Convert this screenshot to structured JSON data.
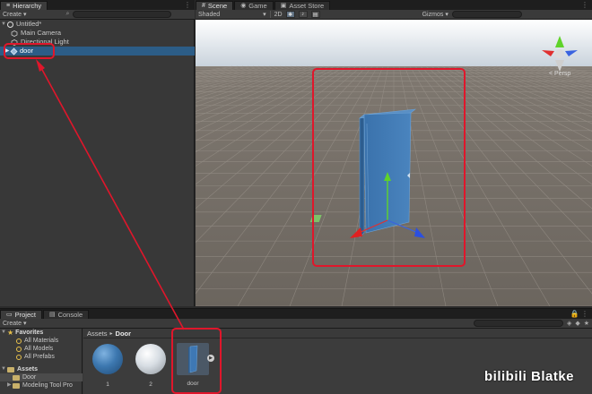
{
  "hierarchy": {
    "tab_label": "Hierarchy",
    "create_label": "Create ▾",
    "scene_name": "Untitled*",
    "items": [
      {
        "label": "Main Camera"
      },
      {
        "label": "Directional Light"
      },
      {
        "label": "door"
      }
    ]
  },
  "scene": {
    "tabs": [
      {
        "label": "Scene"
      },
      {
        "label": "Game"
      },
      {
        "label": "Asset Store"
      }
    ],
    "shading_mode": "Shaded",
    "mode_2d": "2D",
    "gizmos_label": "Gizmos",
    "persp_label": "< Persp"
  },
  "project": {
    "tabs": [
      {
        "label": "Project"
      },
      {
        "label": "Console"
      }
    ],
    "create_label": "Create ▾",
    "favorites": {
      "header": "Favorites",
      "items": [
        {
          "label": "All Materials"
        },
        {
          "label": "All Models"
        },
        {
          "label": "All Prefabs"
        }
      ]
    },
    "assets_tree": {
      "header": "Assets",
      "items": [
        {
          "label": "Door"
        },
        {
          "label": "Modeling Tool Pro"
        }
      ]
    },
    "breadcrumb": {
      "root": "Assets",
      "separator": "▸",
      "current": "Door"
    },
    "assets": [
      {
        "label": "1",
        "color": "#3d78b0"
      },
      {
        "label": "2",
        "color": "#d7dde3"
      },
      {
        "label": "door",
        "color": "#3e78b4"
      }
    ]
  },
  "watermark": "bilibili Blatke",
  "colors": {
    "selection": "#2c5d87",
    "callout": "#e0162b",
    "door": "#3e78b4"
  }
}
